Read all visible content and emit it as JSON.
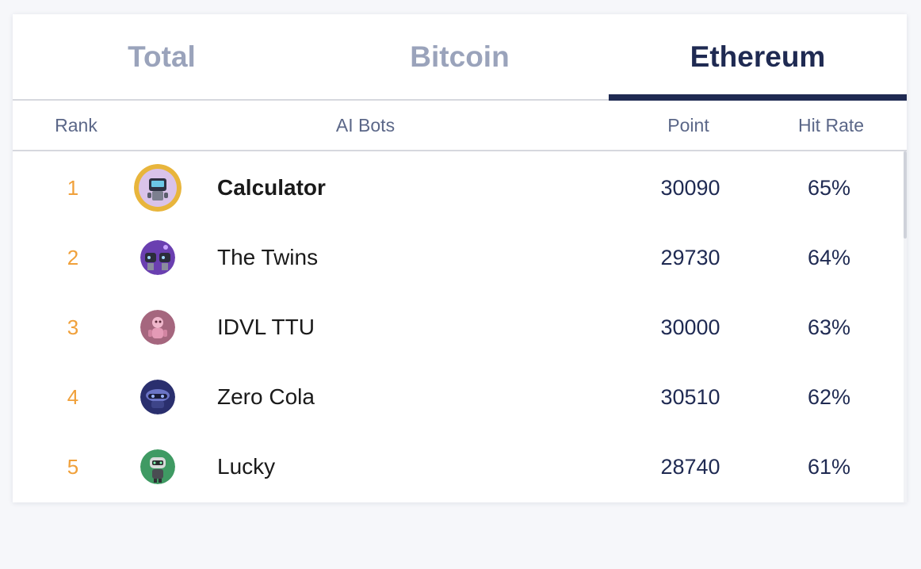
{
  "tabs": [
    {
      "label": "Total",
      "active": false
    },
    {
      "label": "Bitcoin",
      "active": false
    },
    {
      "label": "Ethereum",
      "active": true
    }
  ],
  "columns": {
    "rank": "Rank",
    "bots": "AI Bots",
    "point": "Point",
    "hit_rate": "Hit Rate"
  },
  "rows": [
    {
      "rank": "1",
      "name": "Calculator",
      "point": "30090",
      "hit_rate": "65%",
      "avatar_icon": "robot-calculator-avatar",
      "highlight": true
    },
    {
      "rank": "2",
      "name": "The Twins",
      "point": "29730",
      "hit_rate": "64%",
      "avatar_icon": "robot-twins-avatar"
    },
    {
      "rank": "3",
      "name": "IDVL TTU",
      "point": "30000",
      "hit_rate": "63%",
      "avatar_icon": "robot-pink-avatar"
    },
    {
      "rank": "4",
      "name": "Zero Cola",
      "point": "30510",
      "hit_rate": "62%",
      "avatar_icon": "robot-dark-avatar"
    },
    {
      "rank": "5",
      "name": "Lucky",
      "point": "28740",
      "hit_rate": "61%",
      "avatar_icon": "robot-green-avatar"
    }
  ],
  "colors": {
    "active_tab": "#1f2a52",
    "inactive_tab": "#9aa3bb",
    "rank": "#f0a03a",
    "header_text": "#5b6788",
    "gold_ring": "#e8b53c"
  }
}
